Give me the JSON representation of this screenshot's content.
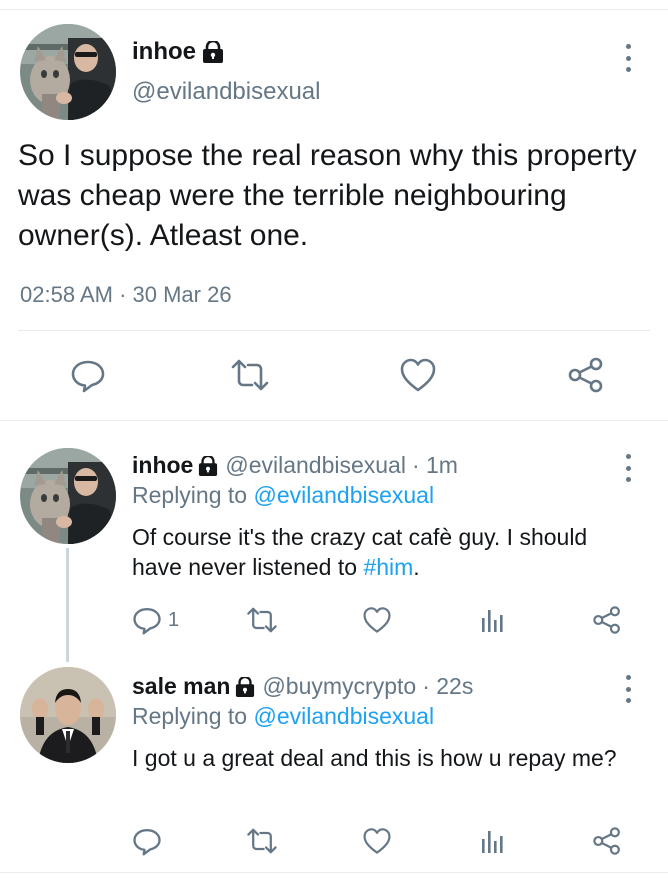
{
  "main_tweet": {
    "author_name": "inhoe",
    "author_handle": "@evilandbisexual",
    "text": "So I suppose the real reason why this property was cheap were the terrible neighbouring owner(s). Atleast one.",
    "timestamp": "02:58 AM · 30 Mar 26",
    "avatar_icon": "avatar-cat-and-man-photo"
  },
  "replies": [
    {
      "author_name": "inhoe",
      "author_handle": "@evilandbisexual",
      "time_ago": "· 1m",
      "replying_prefix": "Replying to",
      "replying_to": "@evilandbisexual",
      "text_before": "Of course it's the crazy cat cafè guy. I should have never listened to ",
      "hashtag": "#him",
      "text_after": ".",
      "reply_count": "1"
    },
    {
      "author_name": "sale man",
      "author_handle": "@buymycrypto",
      "time_ago": "· 22s",
      "replying_prefix": "Replying to",
      "replying_to": "@evilandbisexual",
      "text": "I got u a great deal and this is how u repay me?"
    }
  ],
  "colors": {
    "text": "#14171a",
    "muted": "#657786",
    "link": "#1da1f2",
    "divider": "#e6ecf0"
  }
}
